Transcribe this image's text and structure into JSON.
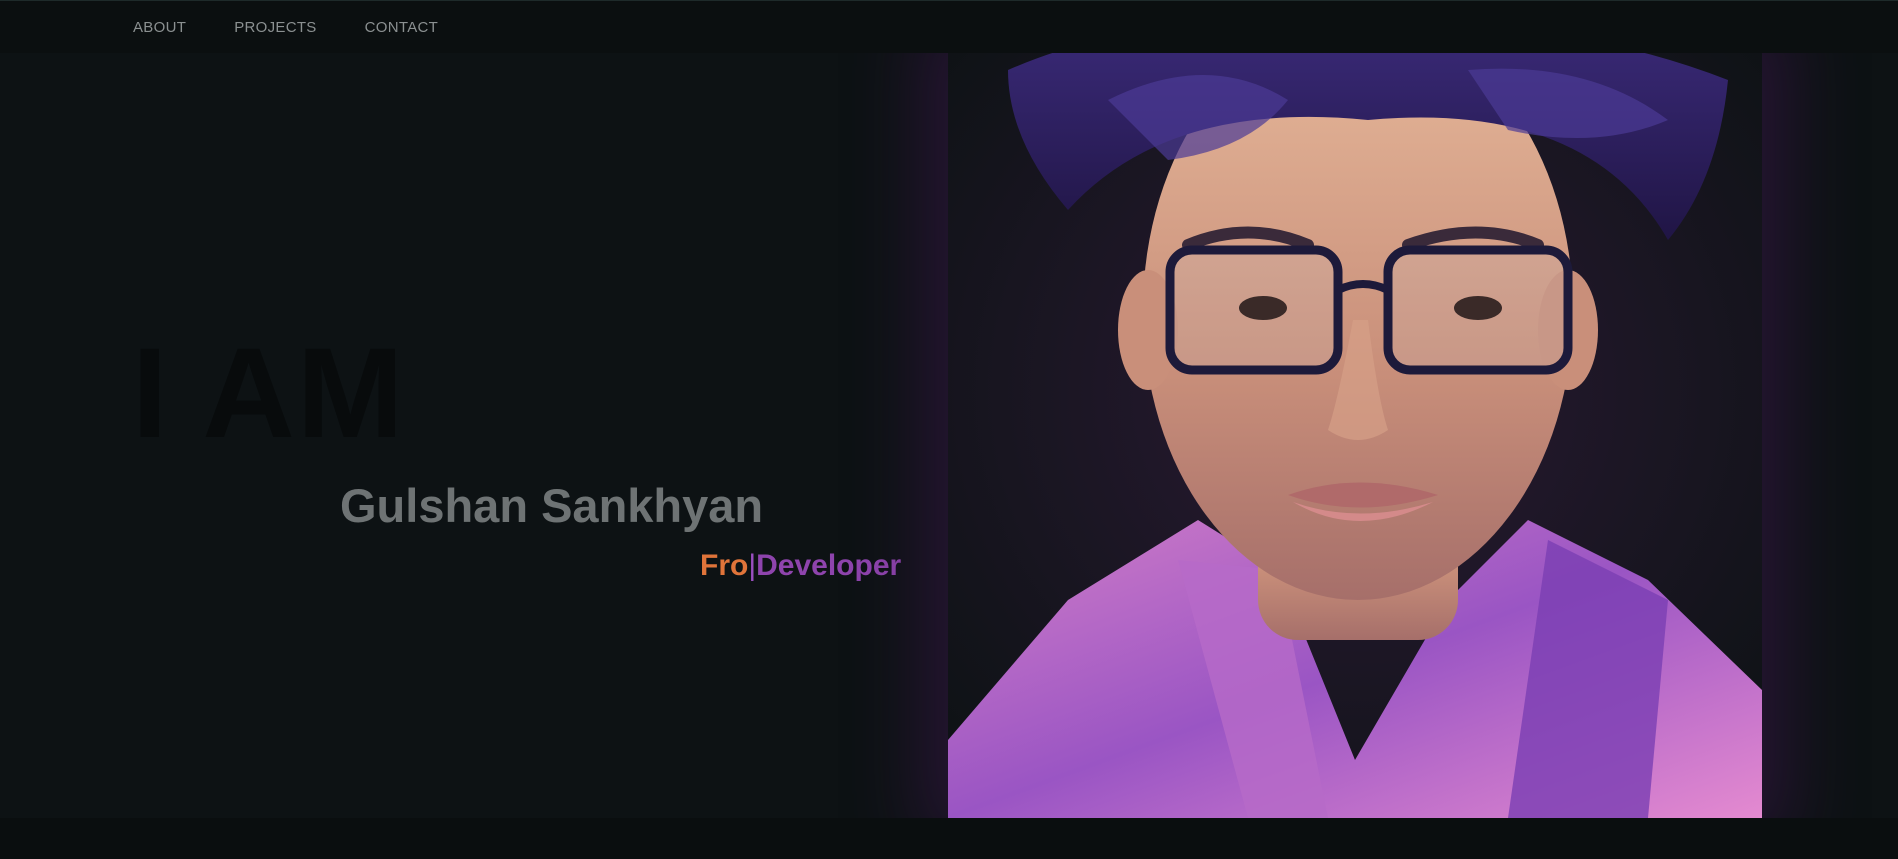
{
  "nav": {
    "items": [
      {
        "label": "ABOUT"
      },
      {
        "label": "PROJECTS"
      },
      {
        "label": "CONTACT"
      }
    ]
  },
  "hero": {
    "intro": "I AM",
    "name": "Gulshan Sankhyan",
    "role": {
      "typed": "Fro",
      "cursor": "|",
      "suffix": "Developer"
    }
  },
  "colors": {
    "background": "#0d1214",
    "navbar": "#0b0f10",
    "name": "#6e7374",
    "role_typed": "#e0743a",
    "role_suffix": "#8e44ad"
  }
}
